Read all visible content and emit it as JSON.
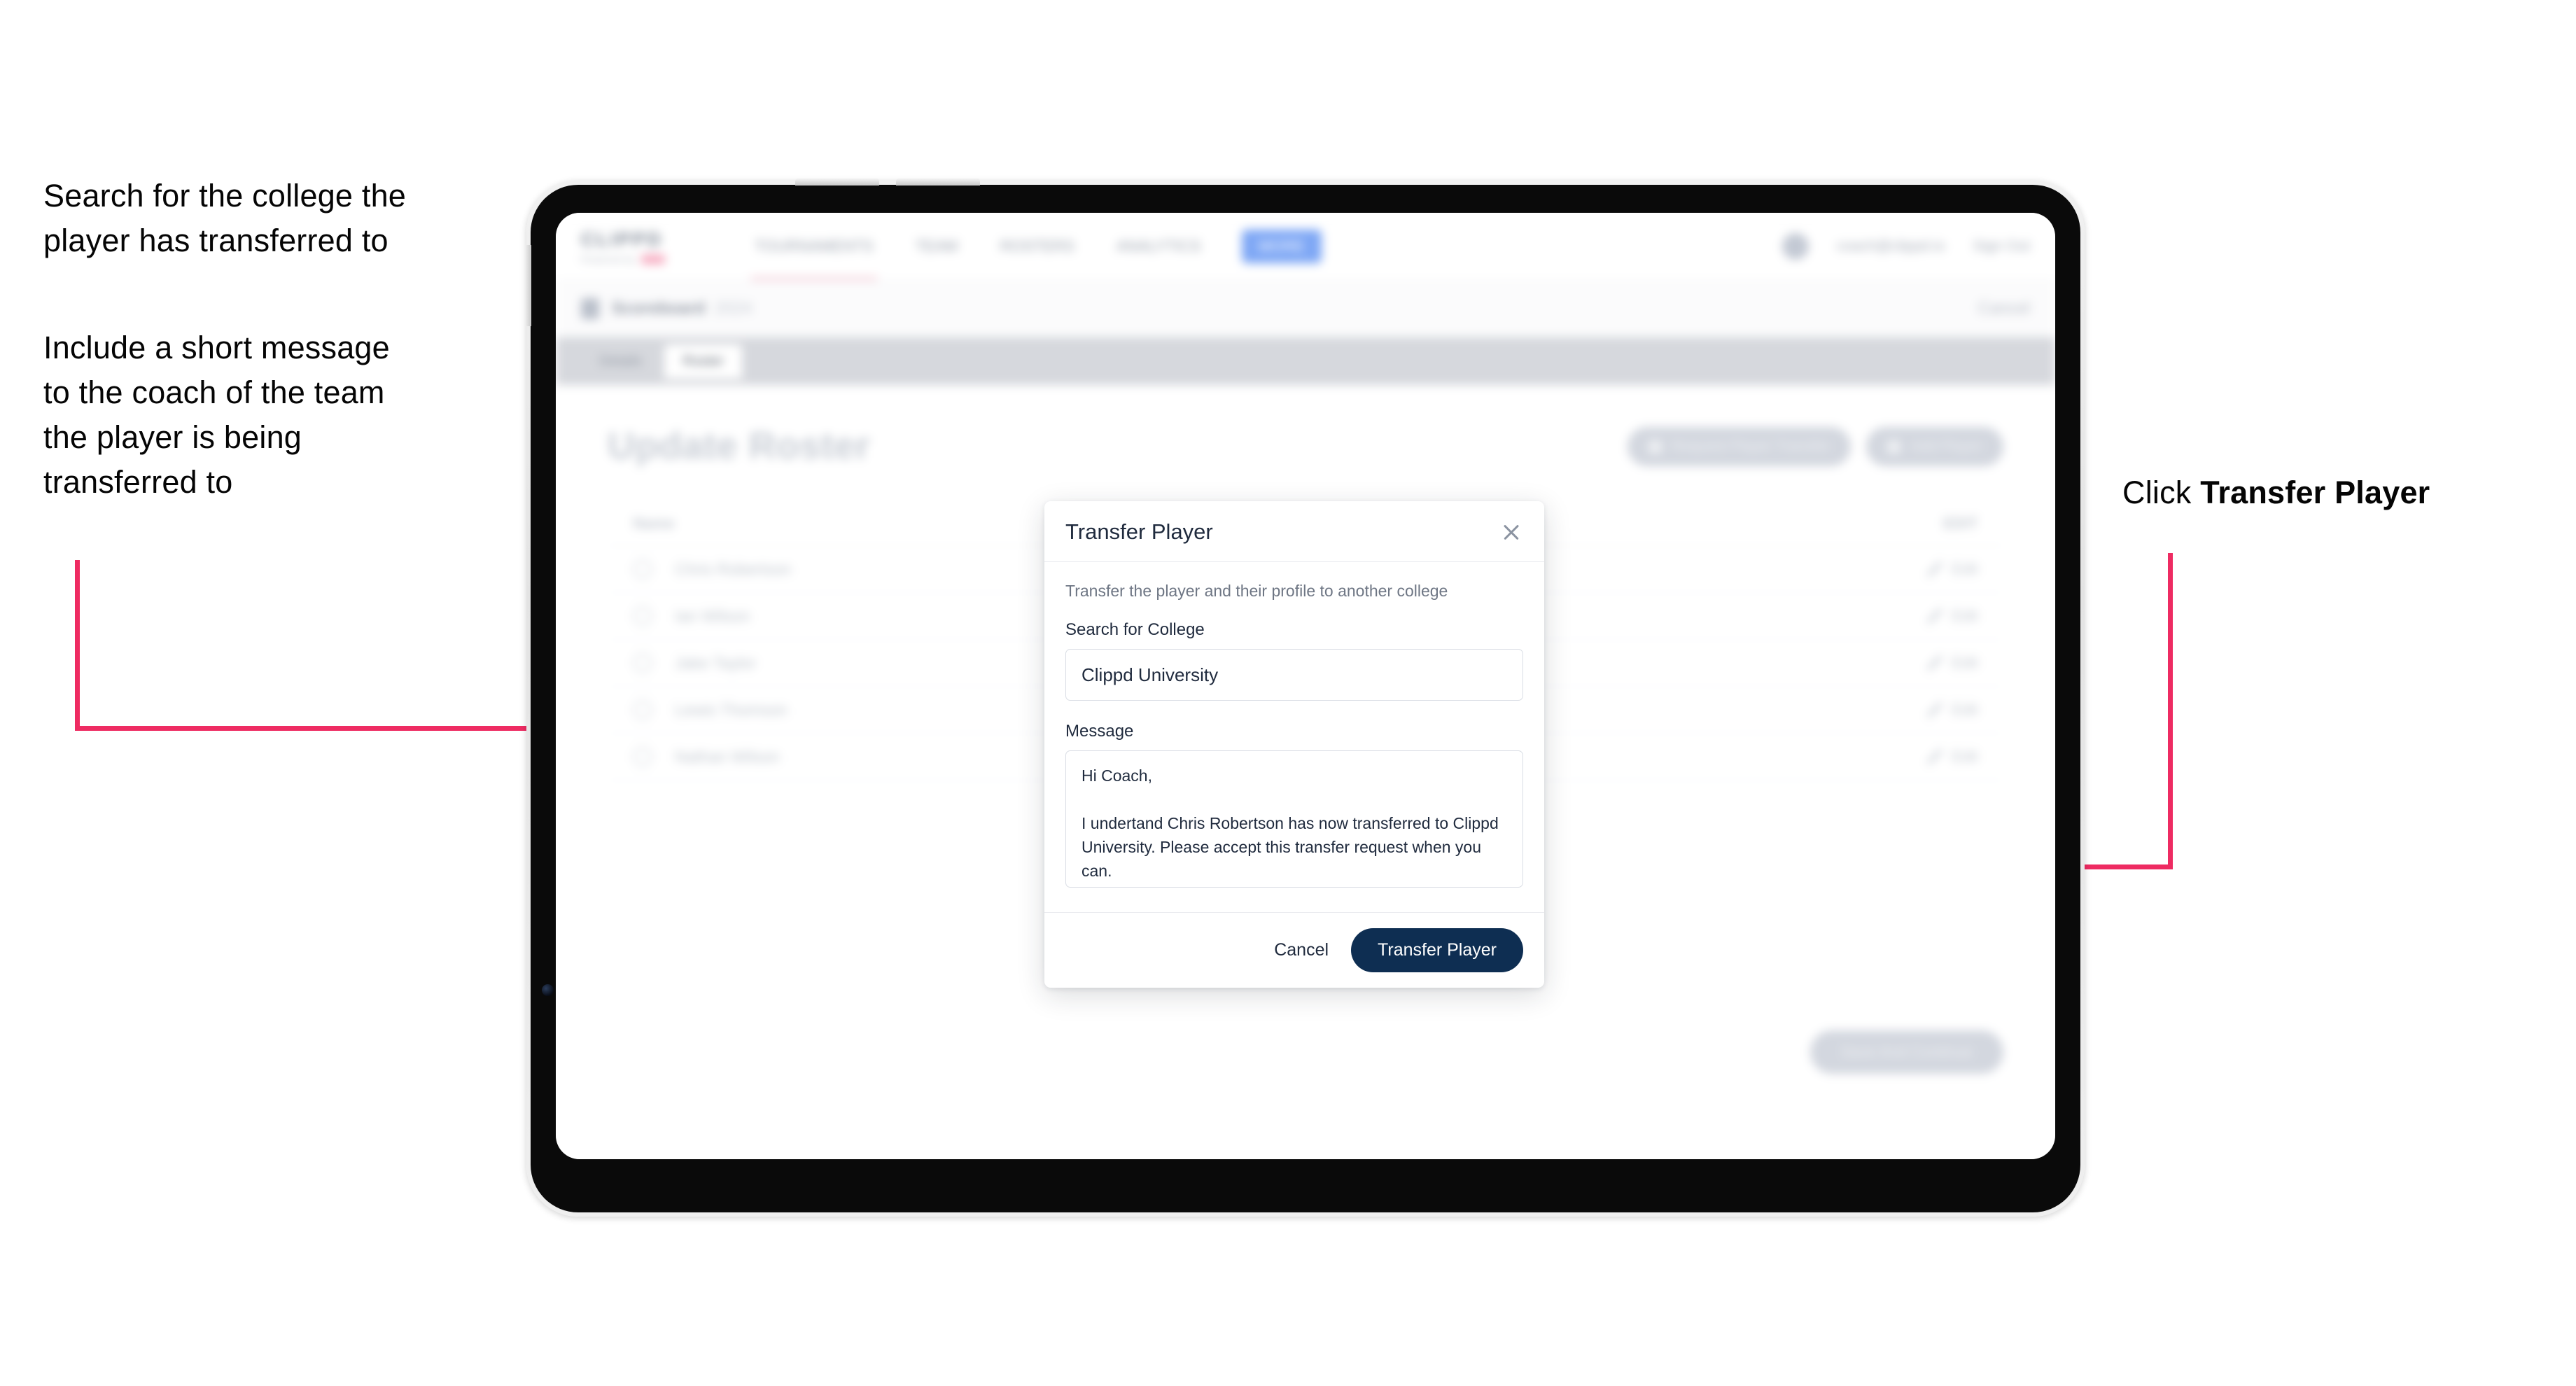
{
  "annotations": {
    "left_1": "Search for the college the\nplayer has transferred to",
    "left_2": "Include a short message\nto the coach of the team\nthe player is being\ntransferred to",
    "right_prefix": "Click ",
    "right_bold": "Transfer Player"
  },
  "app": {
    "brand": {
      "name": "CLIPPD",
      "sub": "Powered by",
      "dot": ""
    },
    "nav": [
      {
        "label": "TOURNAMENTS"
      },
      {
        "label": "TEAM"
      },
      {
        "label": "ROSTERS"
      },
      {
        "label": "ANALYTICS"
      }
    ],
    "nav_pill": "MORE",
    "nav_right": {
      "email": "coach@clippd.io",
      "signout": "Sign Out"
    },
    "breadcrumb": {
      "main": "Scoreboard",
      "sub": "2024",
      "right": "Cancel"
    },
    "tabs": [
      {
        "label": "Details",
        "selected": false
      },
      {
        "label": "Roster",
        "selected": true
      }
    ],
    "page_title": "Update Roster",
    "header_actions": [
      {
        "label": "Request Player Transfer"
      },
      {
        "label": "Add Player"
      }
    ],
    "roster": {
      "col_name": "Name",
      "col_edit": "EDIT",
      "edit_label": "Edit",
      "rows": [
        {
          "name": "Chris Robertson"
        },
        {
          "name": "Ian Wilson"
        },
        {
          "name": "Jake Taylor"
        },
        {
          "name": "Lewis Thomson"
        },
        {
          "name": "Nathan Wilson"
        }
      ]
    },
    "save_button": "Save And Continue"
  },
  "modal": {
    "title": "Transfer Player",
    "close_icon": "close-icon",
    "description": "Transfer the player and their profile to another college",
    "college_label": "Search for College",
    "college_value": "Clippd University",
    "college_placeholder": "Search for College",
    "message_label": "Message",
    "message_value": "Hi Coach,\n\nI undertand Chris Robertson has now transferred to Clippd University. Please accept this transfer request when you can.",
    "message_placeholder": "Message",
    "cancel_label": "Cancel",
    "submit_label": "Transfer Player"
  },
  "colors": {
    "arrow_pink": "#EE2B62",
    "button_navy": "#0E2E52",
    "nav_pill_blue": "#7EA7F5"
  }
}
